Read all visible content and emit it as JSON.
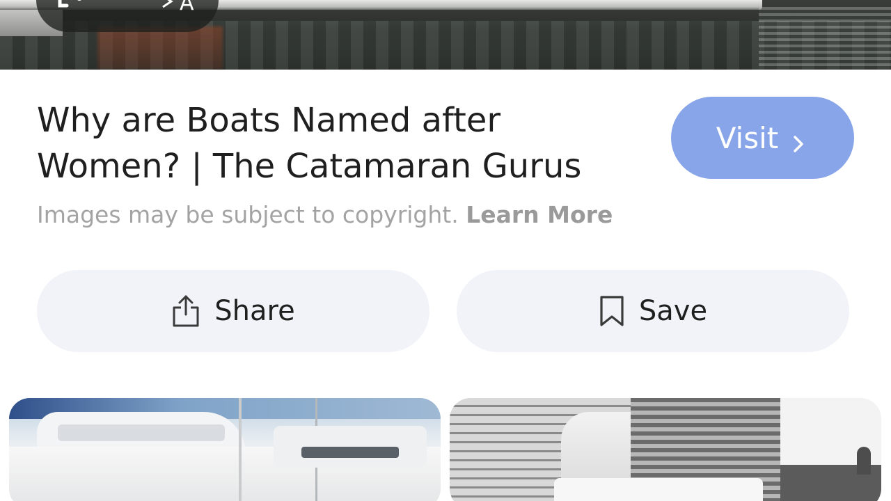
{
  "colors": {
    "visit_button_bg": "#88a5ea",
    "action_button_bg": "#f2f3f9",
    "title_text": "#1f1f1f",
    "muted_text": "#a3a3a3"
  },
  "hero": {
    "lens_icon": "lens-icon",
    "translate_icon_text": "A"
  },
  "result": {
    "title": "Why are Boats Named after Women? | The Catamaran Gurus",
    "visit_label": "Visit",
    "visit_icon": "chevron-right-icon"
  },
  "copyright": {
    "text": "Images may be subject to copyright.",
    "link_label": "Learn More"
  },
  "actions": {
    "share_label": "Share",
    "share_icon": "share-icon",
    "save_label": "Save",
    "save_icon": "bookmark-icon"
  },
  "related": {
    "items": [
      {
        "icon": "catamaran-thumbnail"
      },
      {
        "icon": "cruise-ship-thumbnail"
      }
    ]
  }
}
